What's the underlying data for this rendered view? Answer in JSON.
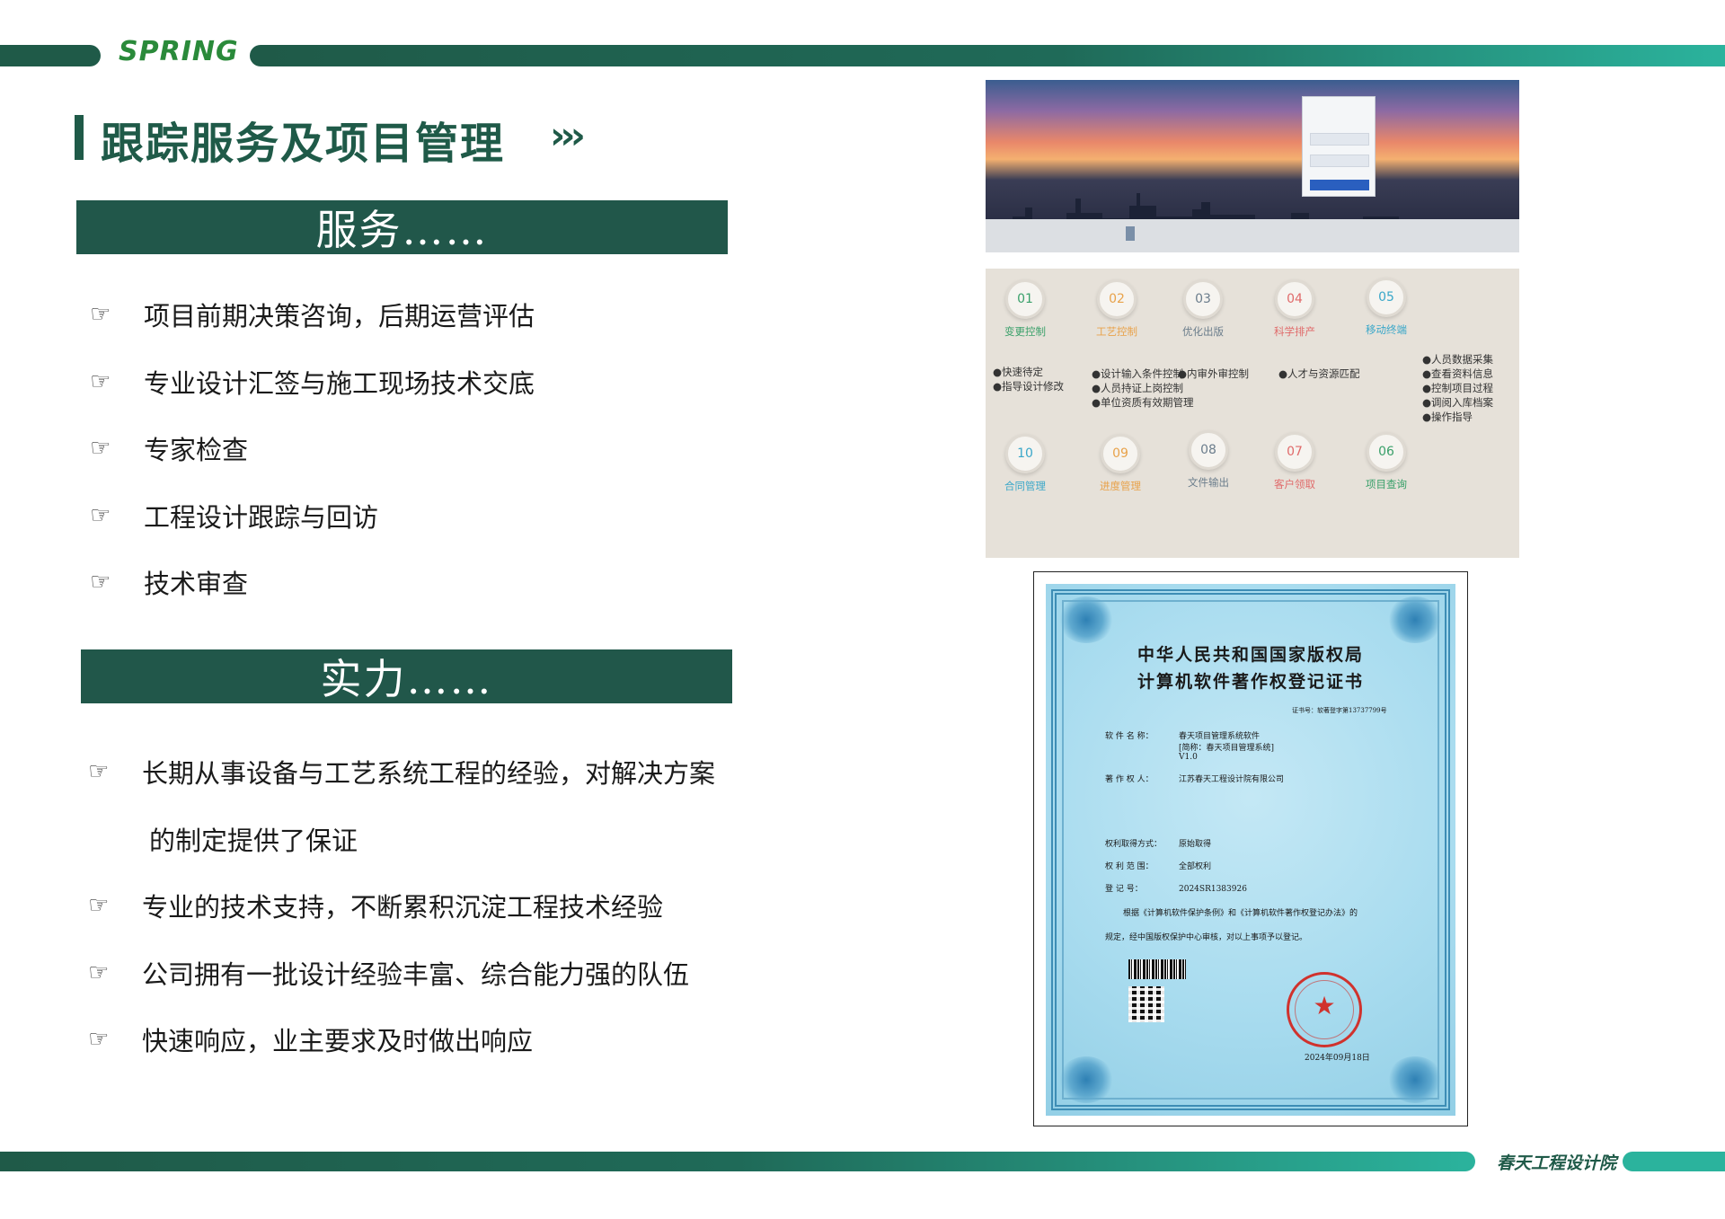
{
  "header": {
    "logo_text": "SPRING",
    "title": "跟踪服务及项目管理",
    "title_arrows": "›››"
  },
  "service": {
    "heading": "服务……",
    "items": [
      "项目前期决策咨询，后期运营评估",
      "专业设计汇签与施工现场技术交底",
      "专家检查",
      "工程设计跟踪与回访",
      "技术审查"
    ]
  },
  "strength": {
    "heading": "实力……",
    "items": [
      "长期从事设备与工艺系统工程的经验，对解决方案",
      " 的制定提供了保证",
      "专业的技术支持，不断累积沉淀工程技术经验",
      "公司拥有一批设计经验丰富、综合能力强的队伍",
      "快速响应，业主要求及时做出响应"
    ]
  },
  "bullet_glyph": "☞",
  "screenshot": {
    "modules": [
      {
        "num": "01",
        "name": "变更控制",
        "color": "#3aa06a"
      },
      {
        "num": "02",
        "name": "工艺控制",
        "color": "#e8a24a"
      },
      {
        "num": "03",
        "name": "优化出版",
        "color": "#6b7d8c"
      },
      {
        "num": "04",
        "name": "科学排产",
        "color": "#e06a6a"
      },
      {
        "num": "05",
        "name": "移动终端",
        "color": "#3aa7c9"
      },
      {
        "num": "10",
        "name": "合同管理",
        "color": "#3aa7c9"
      },
      {
        "num": "09",
        "name": "进度管理",
        "color": "#e8a24a"
      },
      {
        "num": "08",
        "name": "文件输出",
        "color": "#6b7d8c"
      },
      {
        "num": "07",
        "name": "客户领取",
        "color": "#e06a6a"
      },
      {
        "num": "06",
        "name": "项目查询",
        "color": "#3aa06a"
      }
    ],
    "descriptions": [
      [
        "●快速待定",
        "●指导设计修改"
      ],
      [
        "●设计输入条件控制",
        "●人员持证上岗控制",
        "●单位资质有效期管理"
      ],
      [
        "●内审外审控制"
      ],
      [
        "●人才与资源匹配"
      ],
      [
        "●人员数据采集",
        "●查看资料信息",
        "●控制项目过程",
        "●调阅入库档案",
        "●操作指导"
      ]
    ]
  },
  "certificate": {
    "title_line1": "中华人民共和国国家版权局",
    "title_line2": "计算机软件著作权登记证书",
    "cert_no": "证书号：软著登字第13737799号",
    "software_label": "软 件 名 称：",
    "software_name": "春天项目管理系统软件",
    "software_short": "[简称：春天项目管理系统]",
    "version": "V1.0",
    "owner_label": "著 作 权 人：",
    "owner": "江苏春天工程设计院有限公司",
    "method_label": "权利取得方式：",
    "method": "原始取得",
    "scope_label": "权 利 范 围：",
    "scope": "全部权利",
    "reg_label": "登   记   号：",
    "reg_no": "2024SR1383926",
    "body_line1": "根据《计算机软件保护条例》和《计算机软件著作权登记办法》的",
    "body_line2": "规定，经中国版权保护中心审核，对以上事项予以登记。",
    "date": "2024年09月18日"
  },
  "footer": {
    "brand": "春天工程设计院"
  }
}
